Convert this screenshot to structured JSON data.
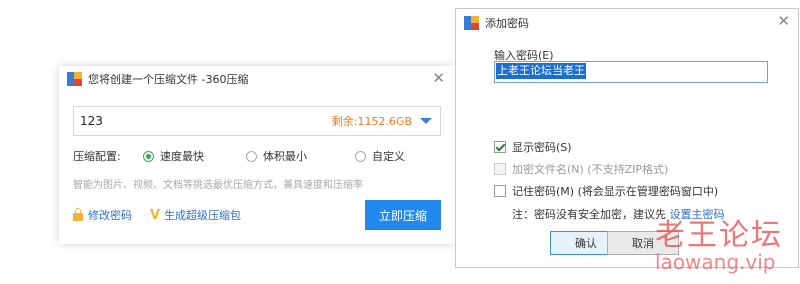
{
  "compress_dialog": {
    "title": "您将创建一个压缩文件 -360压缩",
    "close_glyph": "✕",
    "path_value": "123",
    "free_space": "剩余:1152.6GB",
    "config_label": "压缩配置:",
    "options": [
      "速度最快",
      "体积最小",
      "自定义"
    ],
    "selected_option": "速度最快",
    "hint": "智能为图片、视频、文档等挑选最优压缩方式，兼具速度和压缩率",
    "change_password": "修改密码",
    "create_super_pack": "生成超级压缩包",
    "compress_now": "立即压缩",
    "accent_color": "#2388ec"
  },
  "password_dialog": {
    "title": "添加密码",
    "close_glyph": "✕",
    "input_label": "输入密码(E)",
    "password_value": "上老王论坛当老王",
    "show_password": "显示密码(S)",
    "show_password_checked": true,
    "encrypt_names": "加密文件名(N) (不支持ZIP格式)",
    "encrypt_names_enabled": false,
    "remember_password": "记住密码(M) (将会显示在管理密码窗口中)",
    "remember_password_checked": false,
    "note_prefix": "注：密码没有安全加密，建议先 ",
    "note_link": "设置主密码",
    "ok": "确认",
    "cancel": "取消"
  },
  "watermark": {
    "line1": "老王论坛",
    "line2": "laowang.vip",
    "color": "#e84a4a"
  }
}
